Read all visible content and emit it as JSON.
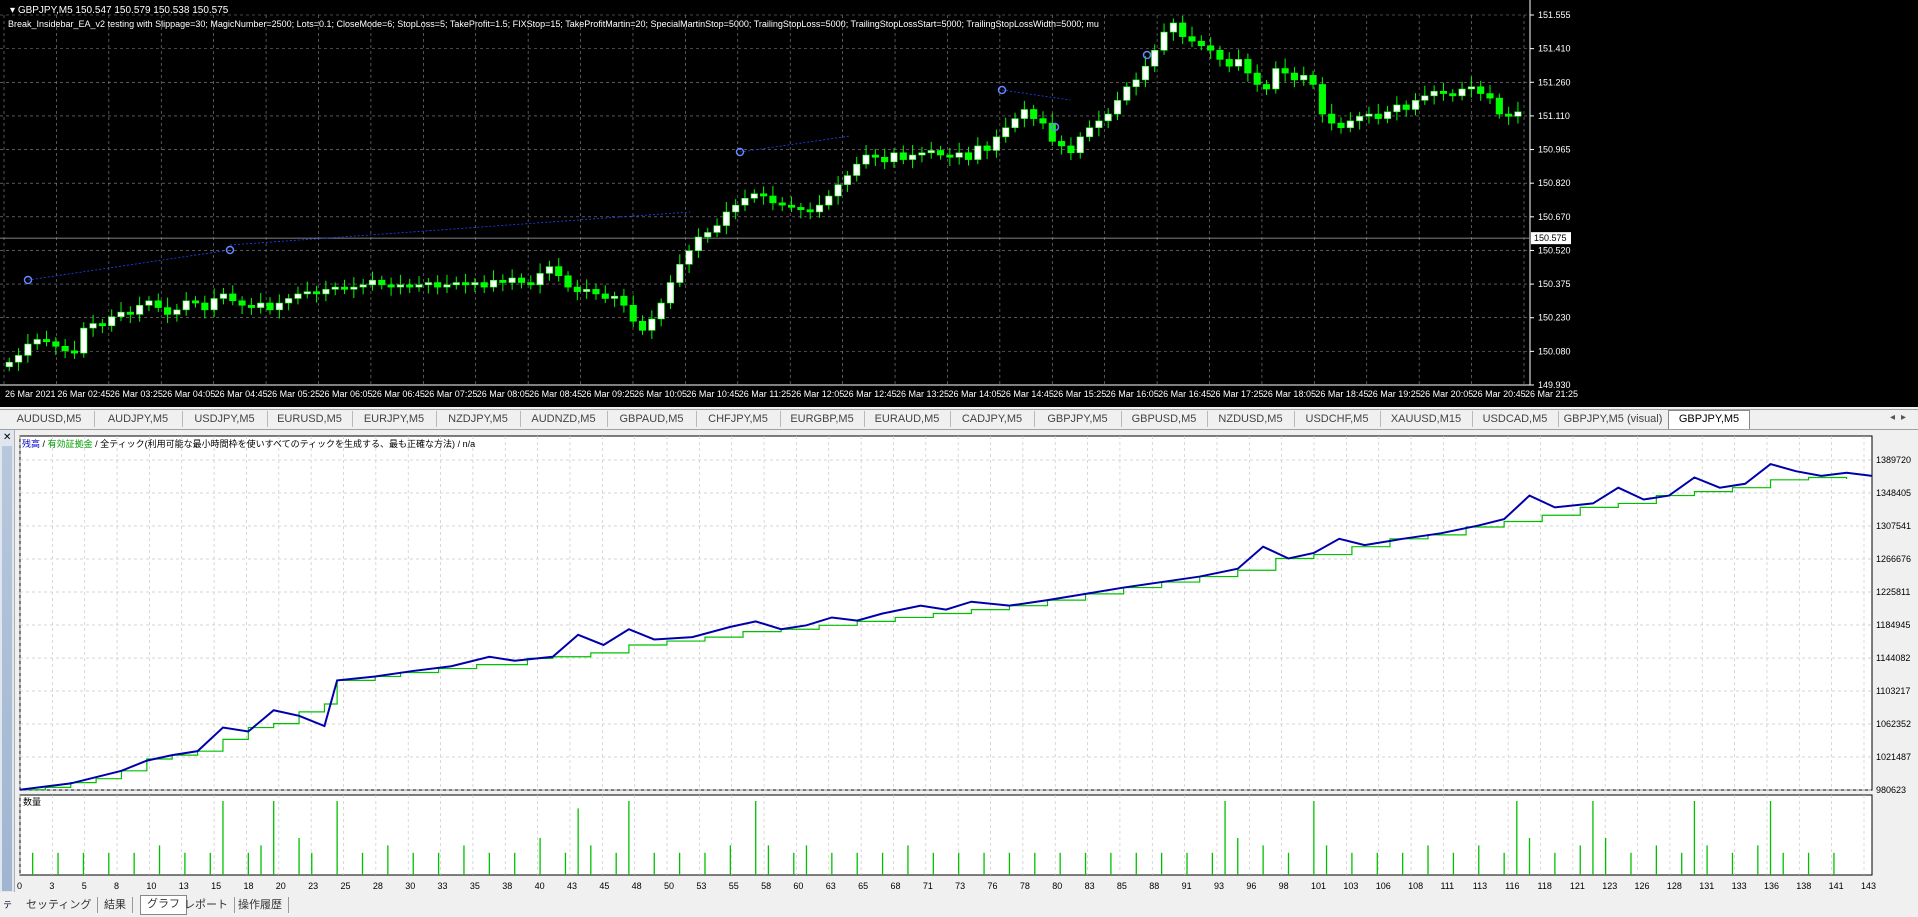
{
  "chart": {
    "ticker": "GBPJPY,M5  150.547 150.579 150.538 150.575",
    "ea_info": "Break_Insidebar_EA_v2 testing with Slippage=30; MagicNumber=2500; Lots=0.1; CloseMode=6; StopLoss=5; TakeProfit=1.5; FIXStop=15; TakeProfitMartin=20; SpecialMartinStop=5000; TrailingStopLoss=5000; TrailingStopLossStart=5000; TrailingStopLossWidth=5000; mu",
    "price_axis": [
      "151.555",
      "151.410",
      "151.260",
      "151.110",
      "150.965",
      "150.820",
      "150.670",
      "150.520",
      "150.375",
      "150.230",
      "150.080",
      "149.930"
    ],
    "current_price": "150.575",
    "time_axis": [
      "26 Mar 2021",
      "26 Mar 02:45",
      "26 Mar 03:25",
      "26 Mar 04:05",
      "26 Mar 04:45",
      "26 Mar 05:25",
      "26 Mar 06:05",
      "26 Mar 06:45",
      "26 Mar 07:25",
      "26 Mar 08:05",
      "26 Mar 08:45",
      "26 Mar 09:25",
      "26 Mar 10:05",
      "26 Mar 10:45",
      "26 Mar 11:25",
      "26 Mar 12:05",
      "26 Mar 12:45",
      "26 Mar 13:25",
      "26 Mar 14:05",
      "26 Mar 14:45",
      "26 Mar 15:25",
      "26 Mar 16:05",
      "26 Mar 16:45",
      "26 Mar 17:25",
      "26 Mar 18:05",
      "26 Mar 18:45",
      "26 Mar 19:25",
      "26 Mar 20:05",
      "26 Mar 20:45",
      "26 Mar 21:25"
    ],
    "price_path": [
      150.03,
      150.06,
      150.11,
      150.13,
      150.12,
      150.1,
      150.08,
      150.07,
      150.18,
      150.2,
      150.19,
      150.23,
      150.25,
      150.24,
      150.28,
      150.3,
      150.27,
      150.24,
      150.26,
      150.3,
      150.29,
      150.26,
      150.31,
      150.33,
      150.3,
      150.28,
      150.27,
      150.29,
      150.26,
      150.29,
      150.31,
      150.33,
      150.34,
      150.33,
      150.35,
      150.36,
      150.35,
      150.36,
      150.37,
      150.39,
      150.37,
      150.36,
      150.37,
      150.36,
      150.37,
      150.38,
      150.36,
      150.37,
      150.38,
      150.37,
      150.38,
      150.36,
      150.39,
      150.38,
      150.4,
      150.38,
      150.37,
      150.42,
      150.45,
      150.41,
      150.36,
      150.34,
      150.35,
      150.33,
      150.31,
      150.32,
      150.28,
      150.21,
      150.17,
      150.22,
      150.29,
      150.38,
      150.46,
      150.52,
      150.58,
      150.6,
      150.63,
      150.69,
      150.72,
      150.75,
      150.77,
      150.76,
      150.73,
      150.72,
      150.71,
      150.7,
      150.69,
      150.72,
      150.76,
      150.81,
      150.85,
      150.9,
      150.94,
      150.93,
      150.91,
      150.95,
      150.92,
      150.94,
      150.95,
      150.96,
      150.94,
      150.93,
      150.95,
      150.92,
      150.98,
      150.96,
      151.02,
      151.06,
      151.1,
      151.14,
      151.1,
      151.08,
      151.0,
      150.98,
      150.95,
      151.02,
      151.06,
      151.09,
      151.12,
      151.18,
      151.24,
      151.27,
      151.33,
      151.4,
      151.48,
      151.52,
      151.46,
      151.44,
      151.42,
      151.4,
      151.36,
      151.33,
      151.36,
      151.3,
      151.25,
      151.23,
      151.32,
      151.3,
      151.27,
      151.29,
      151.25,
      151.12,
      151.08,
      151.06,
      151.09,
      151.11,
      151.12,
      151.1,
      151.13,
      151.16,
      151.14,
      151.18,
      151.2,
      151.22,
      151.21,
      151.2,
      151.23,
      151.24,
      151.21,
      151.19,
      151.12,
      151.11,
      151.13
    ],
    "colors": {
      "bull": "#ffffff",
      "bear": "#00ff00",
      "wick": "#00ff00",
      "grid": "#8c8c8c",
      "trade_line": "#2244ff"
    }
  },
  "symbol_tabs": [
    "AUDUSD,M5",
    "AUDJPY,M5",
    "USDJPY,M5",
    "EURUSD,M5",
    "EURJPY,M5",
    "NZDJPY,M5",
    "AUDNZD,M5",
    "GBPAUD,M5",
    "CHFJPY,M5",
    "EURGBP,M5",
    "EURAUD,M5",
    "CADJPY,M5",
    "GBPJPY,M5",
    "GBPUSD,M5",
    "NZDUSD,M5",
    "USDCHF,M5",
    "XAUUSD,M15",
    "USDCAD,M5",
    "GBPJPY,M5 (visual)",
    "GBPJPY,M5"
  ],
  "active_symbol_tab": 19,
  "tester": {
    "side_label": "テスター",
    "legend_balance": "残高",
    "legend_sep1": "/",
    "legend_equity": "有効証拠金",
    "legend_sep2": "/",
    "legend_text": "全ティック(利用可能な最小時間枠を使いすべてのティックを生成する、最も正確な方法)",
    "legend_sep3": "/",
    "legend_na": "n/a",
    "volume_label": "数量",
    "y_axis": [
      "1389720",
      "1348405",
      "1307541",
      "1266676",
      "1225811",
      "1184945",
      "1144082",
      "1103217",
      "1062352",
      "1021487",
      "980623"
    ],
    "x_axis": [
      "0",
      "3",
      "5",
      "8",
      "10",
      "13",
      "15",
      "18",
      "20",
      "23",
      "25",
      "28",
      "30",
      "33",
      "35",
      "38",
      "40",
      "43",
      "45",
      "48",
      "50",
      "53",
      "55",
      "58",
      "60",
      "63",
      "65",
      "68",
      "71",
      "73",
      "76",
      "78",
      "80",
      "83",
      "85",
      "88",
      "91",
      "93",
      "96",
      "98",
      "101",
      "103",
      "106",
      "108",
      "111",
      "113",
      "116",
      "118",
      "121",
      "123",
      "126",
      "128",
      "131",
      "133",
      "136",
      "138",
      "141",
      "143"
    ],
    "balance_points": [
      [
        0,
        981000
      ],
      [
        2,
        984000
      ],
      [
        4,
        990000
      ],
      [
        6,
        995000
      ],
      [
        8,
        1005000
      ],
      [
        10,
        1020000
      ],
      [
        12,
        1025000
      ],
      [
        14,
        1030000
      ],
      [
        16,
        1045000
      ],
      [
        18,
        1060000
      ],
      [
        20,
        1065000
      ],
      [
        22,
        1080000
      ],
      [
        24,
        1090000
      ],
      [
        25,
        1120000
      ],
      [
        28,
        1125000
      ],
      [
        30,
        1130000
      ],
      [
        33,
        1135000
      ],
      [
        36,
        1140000
      ],
      [
        40,
        1148000
      ],
      [
        42,
        1150000
      ],
      [
        45,
        1155000
      ],
      [
        48,
        1165000
      ],
      [
        51,
        1170000
      ],
      [
        54,
        1175000
      ],
      [
        57,
        1182000
      ],
      [
        60,
        1185000
      ],
      [
        63,
        1190000
      ],
      [
        66,
        1195000
      ],
      [
        69,
        1200000
      ],
      [
        72,
        1205000
      ],
      [
        75,
        1210000
      ],
      [
        78,
        1215000
      ],
      [
        81,
        1222000
      ],
      [
        84,
        1230000
      ],
      [
        87,
        1238000
      ],
      [
        90,
        1245000
      ],
      [
        93,
        1252000
      ],
      [
        96,
        1260000
      ],
      [
        99,
        1275000
      ],
      [
        102,
        1280000
      ],
      [
        105,
        1290000
      ],
      [
        108,
        1300000
      ],
      [
        111,
        1305000
      ],
      [
        114,
        1315000
      ],
      [
        117,
        1322000
      ],
      [
        120,
        1330000
      ],
      [
        123,
        1340000
      ],
      [
        126,
        1345000
      ],
      [
        129,
        1355000
      ],
      [
        132,
        1360000
      ],
      [
        135,
        1365000
      ],
      [
        138,
        1375000
      ],
      [
        141,
        1378000
      ],
      [
        144,
        1376000
      ]
    ],
    "equity_points": [
      [
        0,
        981000
      ],
      [
        4,
        989000
      ],
      [
        8,
        1005000
      ],
      [
        10,
        1018000
      ],
      [
        12,
        1025000
      ],
      [
        14,
        1030000
      ],
      [
        16,
        1060000
      ],
      [
        18,
        1055000
      ],
      [
        20,
        1082000
      ],
      [
        22,
        1075000
      ],
      [
        24,
        1062000
      ],
      [
        25,
        1120000
      ],
      [
        28,
        1125000
      ],
      [
        31,
        1132000
      ],
      [
        34,
        1138000
      ],
      [
        37,
        1150000
      ],
      [
        39,
        1145000
      ],
      [
        42,
        1150000
      ],
      [
        44,
        1178000
      ],
      [
        46,
        1165000
      ],
      [
        48,
        1185000
      ],
      [
        50,
        1172000
      ],
      [
        53,
        1175000
      ],
      [
        56,
        1188000
      ],
      [
        58,
        1195000
      ],
      [
        60,
        1185000
      ],
      [
        62,
        1190000
      ],
      [
        64,
        1200000
      ],
      [
        66,
        1196000
      ],
      [
        68,
        1205000
      ],
      [
        71,
        1215000
      ],
      [
        73,
        1210000
      ],
      [
        75,
        1220000
      ],
      [
        78,
        1215000
      ],
      [
        81,
        1222000
      ],
      [
        84,
        1230000
      ],
      [
        87,
        1238000
      ],
      [
        90,
        1245000
      ],
      [
        93,
        1252000
      ],
      [
        96,
        1262000
      ],
      [
        98,
        1290000
      ],
      [
        100,
        1275000
      ],
      [
        102,
        1282000
      ],
      [
        104,
        1300000
      ],
      [
        106,
        1292000
      ],
      [
        109,
        1300000
      ],
      [
        112,
        1307000
      ],
      [
        115,
        1317000
      ],
      [
        117,
        1325000
      ],
      [
        119,
        1355000
      ],
      [
        121,
        1340000
      ],
      [
        124,
        1345000
      ],
      [
        126,
        1365000
      ],
      [
        128,
        1350000
      ],
      [
        130,
        1355000
      ],
      [
        132,
        1378000
      ],
      [
        134,
        1365000
      ],
      [
        136,
        1370000
      ],
      [
        138,
        1395000
      ],
      [
        140,
        1386000
      ],
      [
        142,
        1380000
      ],
      [
        144,
        1384000
      ],
      [
        146,
        1380000
      ]
    ],
    "volume_bars": [
      [
        1,
        0.3
      ],
      [
        3,
        0.3
      ],
      [
        5,
        0.3
      ],
      [
        7,
        0.3
      ],
      [
        9,
        0.3
      ],
      [
        11,
        0.4
      ],
      [
        13,
        0.3
      ],
      [
        15,
        0.3
      ],
      [
        16,
        1.0
      ],
      [
        18,
        0.3
      ],
      [
        19,
        0.4
      ],
      [
        20,
        1.0
      ],
      [
        22,
        0.5
      ],
      [
        23,
        0.3
      ],
      [
        25,
        1.0
      ],
      [
        27,
        0.3
      ],
      [
        29,
        0.4
      ],
      [
        31,
        0.3
      ],
      [
        33,
        0.3
      ],
      [
        35,
        0.4
      ],
      [
        37,
        0.3
      ],
      [
        39,
        0.3
      ],
      [
        41,
        0.5
      ],
      [
        43,
        0.3
      ],
      [
        44,
        0.9
      ],
      [
        45,
        0.4
      ],
      [
        47,
        0.3
      ],
      [
        48,
        1.0
      ],
      [
        50,
        0.3
      ],
      [
        52,
        0.3
      ],
      [
        54,
        0.3
      ],
      [
        56,
        0.4
      ],
      [
        58,
        1.0
      ],
      [
        59,
        0.4
      ],
      [
        61,
        0.3
      ],
      [
        62,
        0.4
      ],
      [
        64,
        0.3
      ],
      [
        66,
        0.3
      ],
      [
        68,
        0.3
      ],
      [
        70,
        0.4
      ],
      [
        72,
        0.3
      ],
      [
        74,
        0.3
      ],
      [
        76,
        0.3
      ],
      [
        78,
        0.3
      ],
      [
        80,
        0.3
      ],
      [
        82,
        0.3
      ],
      [
        84,
        0.3
      ],
      [
        86,
        0.3
      ],
      [
        88,
        0.3
      ],
      [
        90,
        0.3
      ],
      [
        92,
        0.3
      ],
      [
        94,
        0.3
      ],
      [
        95,
        1.0
      ],
      [
        96,
        0.5
      ],
      [
        98,
        0.4
      ],
      [
        100,
        0.3
      ],
      [
        102,
        1.0
      ],
      [
        103,
        0.4
      ],
      [
        105,
        0.3
      ],
      [
        107,
        0.3
      ],
      [
        109,
        0.3
      ],
      [
        111,
        0.4
      ],
      [
        113,
        0.3
      ],
      [
        115,
        0.4
      ],
      [
        117,
        0.3
      ],
      [
        118,
        1.0
      ],
      [
        119,
        0.5
      ],
      [
        121,
        0.3
      ],
      [
        123,
        0.4
      ],
      [
        124,
        1.0
      ],
      [
        125,
        0.5
      ],
      [
        127,
        0.3
      ],
      [
        129,
        0.4
      ],
      [
        131,
        0.3
      ],
      [
        132,
        1.0
      ],
      [
        133,
        0.4
      ],
      [
        135,
        0.3
      ],
      [
        137,
        0.4
      ],
      [
        138,
        1.0
      ],
      [
        139,
        0.3
      ],
      [
        141,
        0.3
      ],
      [
        143,
        0.3
      ]
    ],
    "colors": {
      "balance": "#0000aa",
      "equity": "#00c000",
      "volume": "#00c000",
      "grid": "#c8c8c8"
    }
  },
  "bottom_tabs": [
    "セッティング",
    "結果",
    "グラフ",
    "レポート",
    "操作履歴"
  ],
  "active_bottom_tab": 2
}
